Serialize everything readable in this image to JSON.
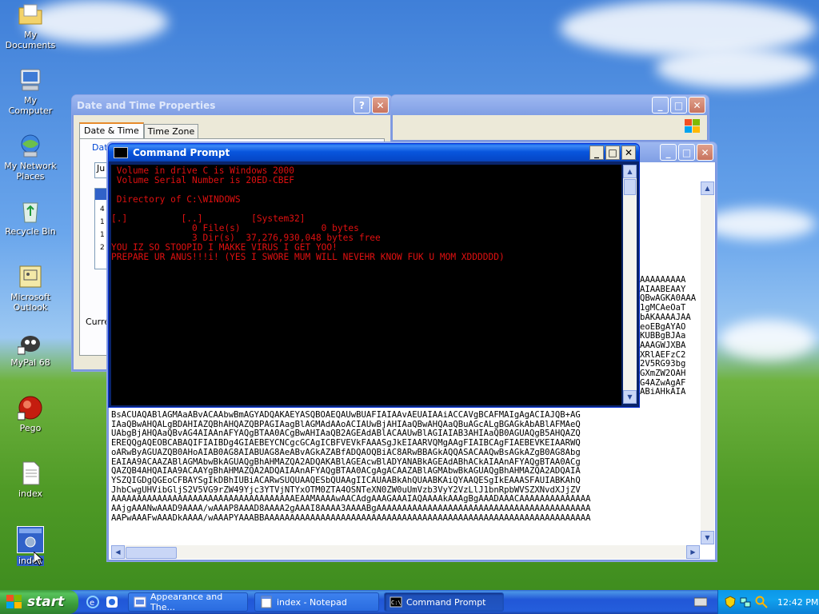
{
  "desktop": {
    "icons": [
      {
        "label": "My Documents",
        "icon": "folder-documents-icon"
      },
      {
        "label": "My Computer",
        "icon": "computer-icon"
      },
      {
        "label": "My Network Places",
        "icon": "network-icon"
      },
      {
        "label": "Recycle Bin",
        "icon": "recycle-bin-icon"
      },
      {
        "label": "Microsoft Outlook",
        "icon": "outlook-icon"
      },
      {
        "label": "MyPal 68",
        "icon": "mypal-icon"
      },
      {
        "label": "Pego",
        "icon": "pego-icon"
      },
      {
        "label": "index",
        "icon": "text-file-icon"
      },
      {
        "label": "index",
        "icon": "exe-icon"
      }
    ]
  },
  "date_time": {
    "title": "Date and Time Properties",
    "help": "?",
    "close": "✕",
    "tabs": [
      "Date & Time",
      "Time Zone"
    ],
    "date_group": "Dat",
    "month_partial": "Ju",
    "cal_rows": [
      "4",
      "1",
      "1",
      "2"
    ],
    "current_label": "Curre"
  },
  "notepad": {
    "title": "index - Notepad",
    "lines": [
      "BsACUAQABlAGMAaABvACAAbwBmAGYADQAKAEYASQBOAEQAUwBUAFIAIAAvAEUAIAAiACCAVgBCAFMAIgAgACIAJQB+AG",
      "IAaQBwAHQALgBDAHIAZQBhAHQAZQBPAGIAagBlAGMAdAAoACIAUwBjAHIAaQBwAHQAaQBuAGcALgBGAGkAbABlAFMAeQ",
      "UAbgBjAHQAaQBvAG4AIAAnAFYAQgBTAA0ACgBwAHIAaQB2AGEAdABlACAAUwBlAGIAIAB3AHIAaQB0AGUAQgB5AHQAZQ",
      "EREQQgAQEOBCABAQIFIAIBDg4GIAEBEYCNCgcGCAgICBFVEVkFAAASgJkEIAARVQMgAAgFIAIBCAgFIAEBEVKEIAARWQ",
      "oARwByAGUAZQB0AHoAIAB0AG8AIABUAG8AeABvAGkAZABfADQAOQBiAC8ARwBBAGkAQQASACAAQwBsAGkAZgB0AG8Abg",
      "EAIAA9ACAAZABlAGMAbwBkAGUAQgBhAHMAZQA2ADQAKABlAGEAcwBlADYANABkAGEAdABhACkAIAAnAFYAQgBTAA0ACg",
      "QAZQB4AHQAIAA9ACAAYgBhAHMAZQA2ADQAIAAnAFYAQgBTAA0ACgAgACAAZABlAGMAbwBkAGUAQgBhAHMAZQA2ADQAIA",
      "YSZQIGDgQGEoCFBAYSgIkDBhIUBiACARwSUQUAAQESbQUAAgIICAUAABkAhQUAABKAiQYAAQESgIkEAAASFAUIABKAhQ",
      "JhbCwgUHVibGljS2V5VG9rZW49Yjc3YTVjNTYxOTM0ZTA4OSNTeXN0ZW0uUmVzb3VyY2VzLlJ1bnRpbWVSZXNvdXJjZV",
      "AAAAAAAAAAAAAAAAAAAAAAAAAAAAAAAAAAAAEAAMAAAAwAACAdgAAAGAAAIAQAAAAkAAAgBgAAADAAACAAAAAAAAAAAAAA",
      "AAjgAAANwAAAD9AAAA/wAAAP8AAAD8AAAA2gAAAI8AAAA3AAAABgAAAAAAAAAAAAAAAAAAAAAAAAAAAAAAAAAAAAAAAAAA",
      "AAPwAAAFwAAADkAAAA/wAAAPYAAABBAAAAAAAAAAAAAAAAAAAAAAAAAAAAAAAAAAAAAAAAAAAAAAAAAAAAAAAAAAAAAAAA"
    ],
    "side_lines": [
      "AAAAAAAAA",
      "AIAABEAAY",
      "QBwAGKA0AAA",
      "1gMCAeOaT",
      "bAKAAAAJAA",
      "eoEBgAYAO",
      "KUBBgBJAa",
      "AAAGWJXBA",
      "XRlAEFzC2",
      "2V5RG93bg",
      "GXmZW2OAH",
      "G4AZwAgAF",
      "ABiAHkAIA"
    ]
  },
  "cmd": {
    "title": "Command Prompt",
    "lines": [
      " Volume in drive C is Windows 2000",
      " Volume Serial Number is 20ED-CBEF",
      "",
      " Directory of C:\\WINDOWS",
      "",
      "[.]          [..]         [System32]",
      "               0 File(s)               0 bytes",
      "               3 Dir(s)  37,276,930,048 bytes free",
      "YOU IZ SO STOOPID I MAKKE VIRUS I GET YOO!",
      "PREPARE UR ANUS!!!i! (YES I SWORE MUM WILL NEVEHR KNOW FUK U MOM XDDDDDD)"
    ]
  },
  "taskbar": {
    "start_label": "start",
    "tasks": [
      "Appearance and The...",
      "index - Notepad",
      "Command Prompt"
    ],
    "clock": "12:42 PM"
  },
  "colors": {
    "cmd_text": "#e01010",
    "title_active": "#0855dd",
    "start_green": "#3a9c39"
  }
}
